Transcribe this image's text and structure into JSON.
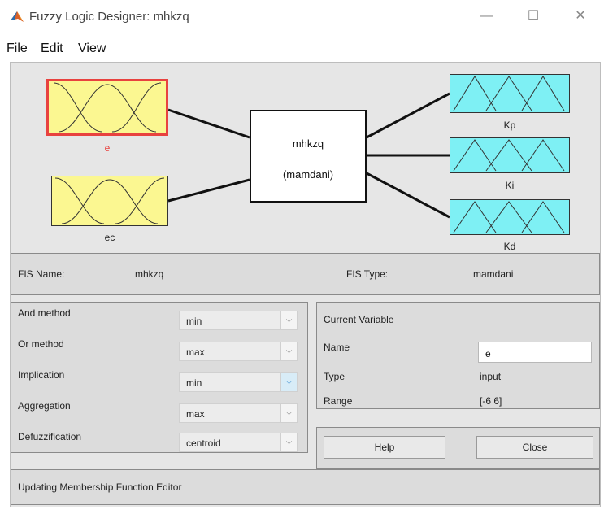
{
  "window": {
    "title": "Fuzzy Logic Designer: mhkzq",
    "minimize_glyph": "—",
    "maximize_glyph": "☐",
    "close_glyph": "✕"
  },
  "menu": [
    "File",
    "Edit",
    "View"
  ],
  "diagram": {
    "inputs": [
      {
        "name": "e",
        "selected": true
      },
      {
        "name": "ec",
        "selected": false
      }
    ],
    "outputs": [
      {
        "name": "Kp"
      },
      {
        "name": "Ki"
      },
      {
        "name": "Kd"
      }
    ],
    "fis_box": {
      "name": "mhkzq",
      "type": "(mamdani)"
    }
  },
  "fis_info": {
    "name_label": "FIS Name:",
    "name_value": "mhkzq",
    "type_label": "FIS Type:",
    "type_value": "mamdani"
  },
  "methods": [
    {
      "label": "And method",
      "value": "min"
    },
    {
      "label": "Or method",
      "value": "max"
    },
    {
      "label": "Implication",
      "value": "min"
    },
    {
      "label": "Aggregation",
      "value": "max"
    },
    {
      "label": "Defuzzification",
      "value": "centroid"
    }
  ],
  "current_variable": {
    "title": "Current Variable",
    "name_label": "Name",
    "name_value": "e",
    "type_label": "Type",
    "type_value": "input",
    "range_label": "Range",
    "range_value": "[-6 6]"
  },
  "buttons": {
    "help": "Help",
    "close": "Close"
  },
  "status": "Updating Membership Function Editor",
  "colors": {
    "input_box": "#fbf791",
    "output_box": "#7ef0f4",
    "selected_border": "#e8423f",
    "selected_label": "#e8423f"
  },
  "icons": {
    "app": "matlab-logo-icon",
    "dropdown": "chevron-down-icon"
  }
}
